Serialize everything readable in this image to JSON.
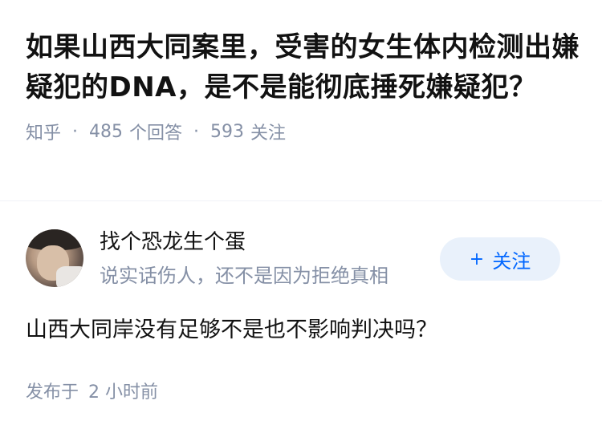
{
  "question": {
    "title": "如果山西大同案里，受害的女生体内检测出嫌疑犯的DNA，是不是能彻底捶死嫌疑犯？",
    "source": "知乎",
    "answer_count": "485",
    "answer_label": "个回答",
    "follower_count": "593",
    "follower_label": "关注"
  },
  "author": {
    "name": "找个恐龙生个蛋",
    "bio": "说实话伤人，还不是因为拒绝真相",
    "follow_button": {
      "icon": "+",
      "label": "关注"
    }
  },
  "answer": {
    "text": "山西大同岸没有足够不是也不影响判决吗？",
    "posted_prefix": "发布于",
    "posted_time": "2 小时前"
  },
  "colors": {
    "meta_gray": "#8590a6",
    "primary_blue": "#0066ff",
    "button_bg": "#e9f1fb",
    "text": "#121212"
  }
}
